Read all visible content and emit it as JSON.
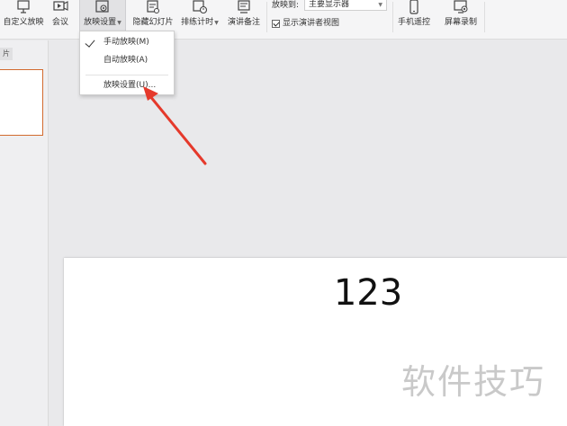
{
  "ribbon": {
    "buttons": [
      {
        "label": "自定义放映",
        "icon": "custom-show-icon"
      },
      {
        "label": "会议",
        "icon": "meeting-icon"
      },
      {
        "label": "放映设置",
        "icon": "slideshow-settings-icon",
        "active": true
      },
      {
        "label": "隐藏幻灯片",
        "icon": "hide-slide-icon"
      },
      {
        "label": "排练计时",
        "icon": "rehearse-timing-icon"
      },
      {
        "label": "演讲备注",
        "icon": "speaker-notes-icon"
      },
      {
        "label": "手机遥控",
        "icon": "phone-remote-icon"
      },
      {
        "label": "屏幕录制",
        "icon": "screen-record-icon"
      }
    ],
    "show_on_label": "放映到:",
    "show_on_value": "主要显示器",
    "presenter_view_label": "显示演讲者视图",
    "presenter_view_checked": true
  },
  "dropdown": {
    "items": [
      {
        "label": "手动放映(M)",
        "checked": true
      },
      {
        "label": "自动放映(A)",
        "checked": false
      },
      {
        "label": "放映设置(U)...",
        "checked": false
      }
    ]
  },
  "left_panel": {
    "tab_label": "片"
  },
  "slide": {
    "text": "123"
  },
  "watermark": "软件技巧",
  "colors": {
    "accent_red": "#e5392b",
    "thumb_border": "#d26a2e"
  }
}
